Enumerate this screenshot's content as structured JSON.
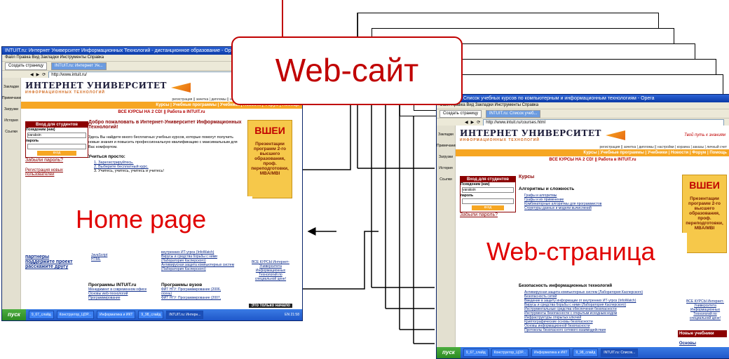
{
  "labels": {
    "website": "Web-сайт",
    "homepage": "Home page",
    "webpage": "Web-страница"
  },
  "home_window": {
    "title": "INTUIT.ru: Интернет Университет Информационных Технологий - дистанционное образование - Opera",
    "menu": "Файл  Правка  Вид  Закладки  Инструменты  Справка",
    "tab_create": "Создать страницу",
    "tab_active": "INTUIT.ru: Интернет Ун...",
    "address": "http://www.intuit.ru/",
    "sidebar": [
      "Закладки",
      "Примечания",
      "Загрузки",
      "История",
      "Ссылки"
    ],
    "logo": "ИНТЕРНЕТ УНИВЕРСИТЕТ",
    "logo_sub": "ИНФОРМАЦИОННЫХ ТЕХНОЛОГИЙ",
    "nav": "регистрация || зачетка | дипломы || настройки | корзина | заказы | личный счет",
    "orange_bar": "Курсы | Учебные программы | Учебники | Новости | Форум | Помощь",
    "all_courses": "ВСЕ КУРСЫ НА 2 CD! || Работа в INTUIT.ru",
    "login_header": "Вход для студентов",
    "login_pseudonym": "Псевдоним (ник)",
    "login_value": "varaksin",
    "login_password": "пароль",
    "login_button": "вход",
    "forgot": "Забыли пароль?",
    "register": "Регистрация новых пользователей",
    "welcome": "Добро пожаловать в Интернет-Университет Информационных Технологий!",
    "intro": "Здесь Вы найдете много бесплатных учебных курсов, которые помогут получить новые знания и повысить профессиональную квалификацию с максимальным для Вас комфортом.",
    "learn_title": "Учиться просто:",
    "steps": [
      "1. Зарегистрируйтесь.",
      "2. Выберите бесплатный курс.",
      "3. Учитесь, учитесь, учитесь и учитесь!"
    ],
    "side_links": [
      "партнеры",
      "поддержите проект",
      "расскажите другу"
    ],
    "list_left": [
      "JavaScript",
      "HTML"
    ],
    "list_right": [
      "внутренних ИТ-угроз (InfoWatch)",
      "Вирусы и средства борьбы с ними (Лаборатория Касперского)",
      "Антивирусная защита компьютерных систем (Лаборатория Касперского)"
    ],
    "programs_title": "Программы INTUIT.ru",
    "programs": [
      "Менеджмент в современном офисе",
      "Основы web-технологий",
      "Программирование"
    ],
    "vuz_title": "Программы вузов",
    "vuz": [
      "ФИТ НГУ: Программирование (2006, осень)",
      "ФИТ НГУ: Программирование (2007,"
    ],
    "ad_name": "ВШЕИ",
    "ad_text": "Презентации программ 2-го высшего образования, проф. переподготовки, MBA/MBI",
    "cd_block": "ВСЕ КУРСЫ Интернет-Университета Информационных Технологий по специальной цене!",
    "ad_bottom": "Это только начало",
    "start": "пуск",
    "tasks": [
      "9_67_слайд",
      "Конструктор_ЦОР...",
      "Информатика и ИКТ",
      "9_98_слайд",
      "INTUIT.ru: Интерн..."
    ],
    "clock": "EN 21:58"
  },
  "page_window": {
    "title": "INTUIT.ru: Список учебных курсов по компьютерным и информационным технологиям - Opera",
    "menu": "Файл  Правка  Вид  Закладки  Инструменты  Справка",
    "tab_create": "Создать страницу",
    "tab_active": "INTUIT.ru: Список учеб...",
    "address": "http://www.intuit.ru/courses.html",
    "motto": "Твой путь к знаниям",
    "courses_title": "Курсы",
    "algo_title": "Алгоритмы и сложность",
    "algo": [
      "Графы и алгоритмы",
      "Графы и их применение",
      "Комбинаторные алгоритмы для программистов",
      "Структуры данных и модели вычислений"
    ],
    "security_title": "Безопасность информационных технологий",
    "security": [
      "Антивирусная защита компьютерных систем (Лаборатория Касперского)",
      "Безопасность сетей",
      "Введение в защиту информации от внутренних ИТ-угроз (InfoWatch)",
      "Вирусы и средства борьбы с ними (Лаборатория Касперского)",
      "Инструментальные средства обеспечения безопасности",
      "Инструменты безопасности с открытым исходным кодом",
      "Инфраструктуры открытых ключей",
      "Криптографические основы безопасности",
      "Основы информационной безопасности",
      "Протоколы безопасного сетевого взаимодействия"
    ],
    "new_books": "Новые учебники",
    "basics": "Основы",
    "tasks": [
      "9_67_слайд",
      "Конструктор_ЦОР...",
      "Информатика и ИКТ",
      "9_98_слайд",
      "INTUIT.ru: Список..."
    ]
  },
  "colors": {
    "accent_red": "#c00000",
    "orange": "#f6a623",
    "xp_blue": "#1f57c9"
  }
}
